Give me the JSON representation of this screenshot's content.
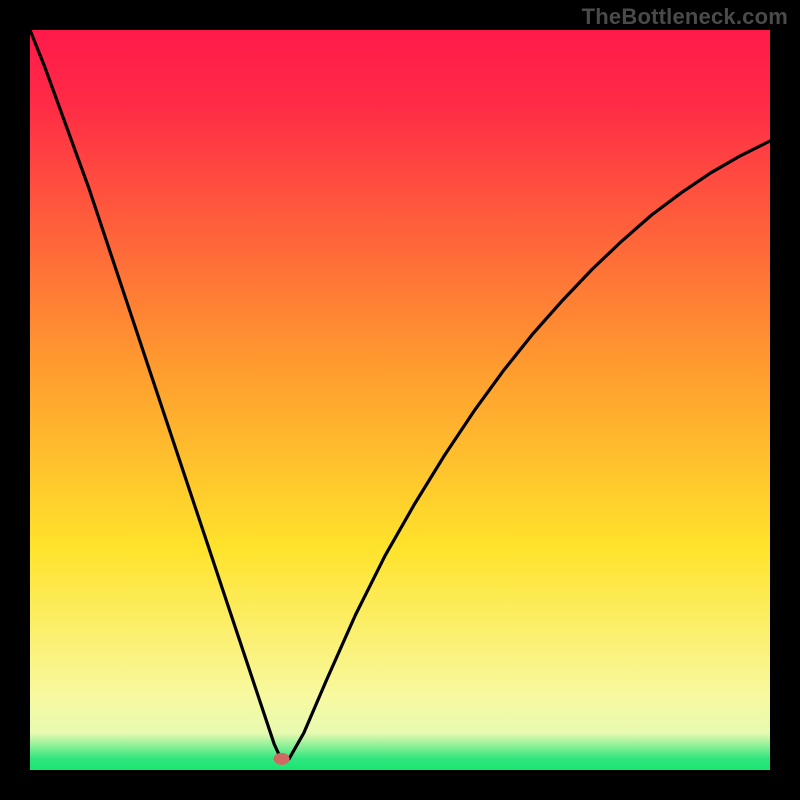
{
  "watermark": "TheBottleneck.com",
  "colors": {
    "top": "#ff1a4a",
    "red": "#ff2b46",
    "orange": "#ff9a2f",
    "yellow": "#ffe32b",
    "pale": "#f8f9a0",
    "pale2": "#e7fab0",
    "green": "#2fe67e",
    "green2": "#17e773",
    "line": "#000000",
    "marker": "#cf6a63"
  },
  "chart_data": {
    "type": "line",
    "title": "",
    "xlabel": "",
    "ylabel": "",
    "xlim": [
      0,
      100
    ],
    "ylim": [
      0,
      100
    ],
    "annotations": [
      "TheBottleneck.com"
    ],
    "marker": {
      "x": 34,
      "y": 1.5
    },
    "x": [
      0,
      2,
      4,
      6,
      8,
      10,
      12,
      14,
      16,
      18,
      20,
      22,
      24,
      26,
      28,
      30,
      32,
      33,
      34,
      35,
      37,
      40,
      44,
      48,
      52,
      56,
      60,
      64,
      68,
      72,
      76,
      80,
      84,
      88,
      92,
      96,
      100
    ],
    "y": [
      100,
      95,
      89.5,
      84,
      78.5,
      72.5,
      66.5,
      60.5,
      54.5,
      48.5,
      42.5,
      36.5,
      30.5,
      24.5,
      18.5,
      12.5,
      6.5,
      3.5,
      1.3,
      1.5,
      5,
      12,
      21,
      29,
      36,
      42.5,
      48.5,
      54,
      59,
      63.5,
      67.7,
      71.5,
      75,
      78,
      80.7,
      83,
      85
    ]
  }
}
